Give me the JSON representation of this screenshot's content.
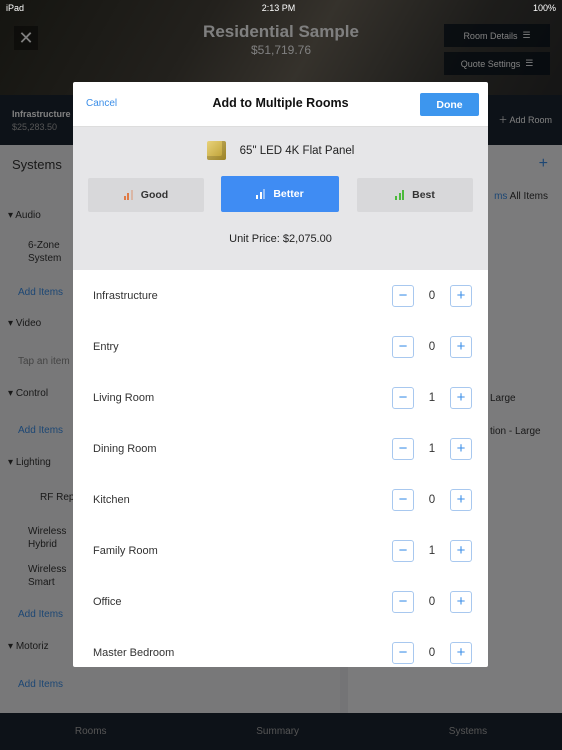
{
  "status": {
    "device": "iPad",
    "time": "2:13 PM",
    "battery": "100%"
  },
  "header": {
    "title": "Residential Sample",
    "total": "$51,719.76",
    "room_details": "Room Details",
    "quote_settings": "Quote Settings"
  },
  "room_tab": {
    "name": "Infrastructure",
    "price": "$25,283.50",
    "add_room": "Add Room"
  },
  "left_panel": {
    "title": "Systems",
    "sections": [
      {
        "name": "Audio",
        "items": [
          "6-Zone System"
        ],
        "add": "Add Items"
      },
      {
        "name": "Video",
        "hint": "Tap an item"
      },
      {
        "name": "Control",
        "add": "Add Items"
      },
      {
        "name": "Lighting",
        "items": [
          "RF Rep",
          "Wireless Hybrid",
          "Wireless Smart"
        ],
        "add": "Add Items"
      },
      {
        "name": "Motoriz",
        "add": "Add Items"
      }
    ]
  },
  "right_panel": {
    "filter_a": "ms",
    "filter_b": "All Items",
    "items": [
      "Large",
      "tion - Large"
    ]
  },
  "tabbar": [
    "Rooms",
    "Summary",
    "Systems"
  ],
  "modal": {
    "cancel": "Cancel",
    "title": "Add to Multiple Rooms",
    "done": "Done",
    "product": "65\" LED 4K Flat Panel",
    "tiers": [
      {
        "label": "Good",
        "color": "#e07a45"
      },
      {
        "label": "Better",
        "color": "#ffffff",
        "selected": true
      },
      {
        "label": "Best",
        "color": "#4cba3c"
      }
    ],
    "unit_price": "Unit Price: $2,075.00",
    "rooms": [
      {
        "name": "Infrastructure",
        "qty": "0"
      },
      {
        "name": "Entry",
        "qty": "0"
      },
      {
        "name": "Living Room",
        "qty": "1"
      },
      {
        "name": "Dining Room",
        "qty": "1"
      },
      {
        "name": "Kitchen",
        "qty": "0"
      },
      {
        "name": "Family Room",
        "qty": "1"
      },
      {
        "name": "Office",
        "qty": "0"
      },
      {
        "name": "Master Bedroom",
        "qty": "0"
      }
    ]
  },
  "colors": {
    "accent": "#3d96ee",
    "selected_tier": "#3f8cf3"
  }
}
